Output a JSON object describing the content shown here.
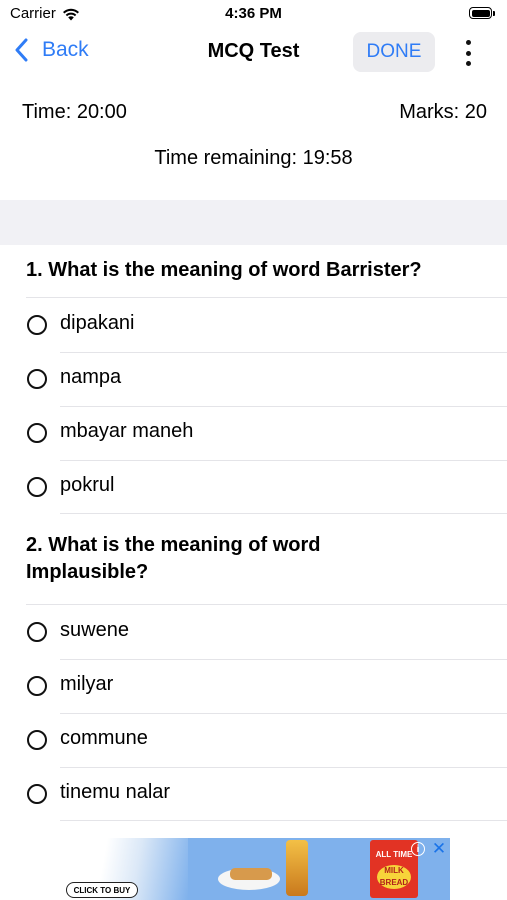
{
  "status_bar": {
    "carrier": "Carrier",
    "time": "4:36 PM"
  },
  "nav": {
    "back_label": "Back",
    "title": "MCQ Test",
    "done_label": "DONE"
  },
  "info": {
    "time_total": "Time: 20:00",
    "marks": "Marks: 20",
    "time_remaining": "Time remaining: 19:58"
  },
  "questions": [
    {
      "title": "1. What is the meaning of word Barrister?",
      "options": [
        "dipakani",
        "nampa",
        "mbayar maneh",
        "pokrul"
      ]
    },
    {
      "title": "2. What is the meaning of word Implausible?",
      "options": [
        "suwene",
        "milyar",
        "commune",
        "tinemu nalar"
      ]
    }
  ],
  "ad": {
    "cta": "CLICK TO BUY",
    "brand_top": "ALL TIME",
    "brand_badge": "MILK BREAD"
  }
}
